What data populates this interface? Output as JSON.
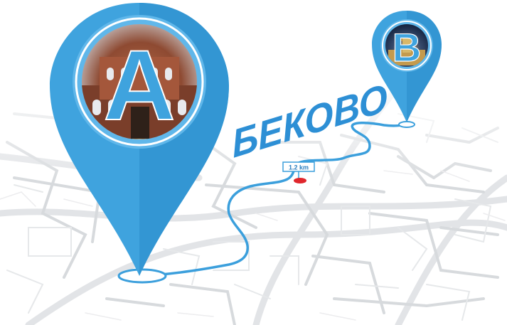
{
  "town_name": "БЕКОВО",
  "pin_a": {
    "letter": "A"
  },
  "pin_b": {
    "letter": "B"
  },
  "distance_marker": {
    "label": "1.2 km"
  },
  "colors": {
    "pin_blue": "#3fa3de",
    "pin_blue_dark": "#2a8ccb",
    "route_blue": "#3b9fdc",
    "title_blue": "#2d8fd5",
    "marker_red": "#e0262c",
    "map_roads": "#d7dadd"
  }
}
